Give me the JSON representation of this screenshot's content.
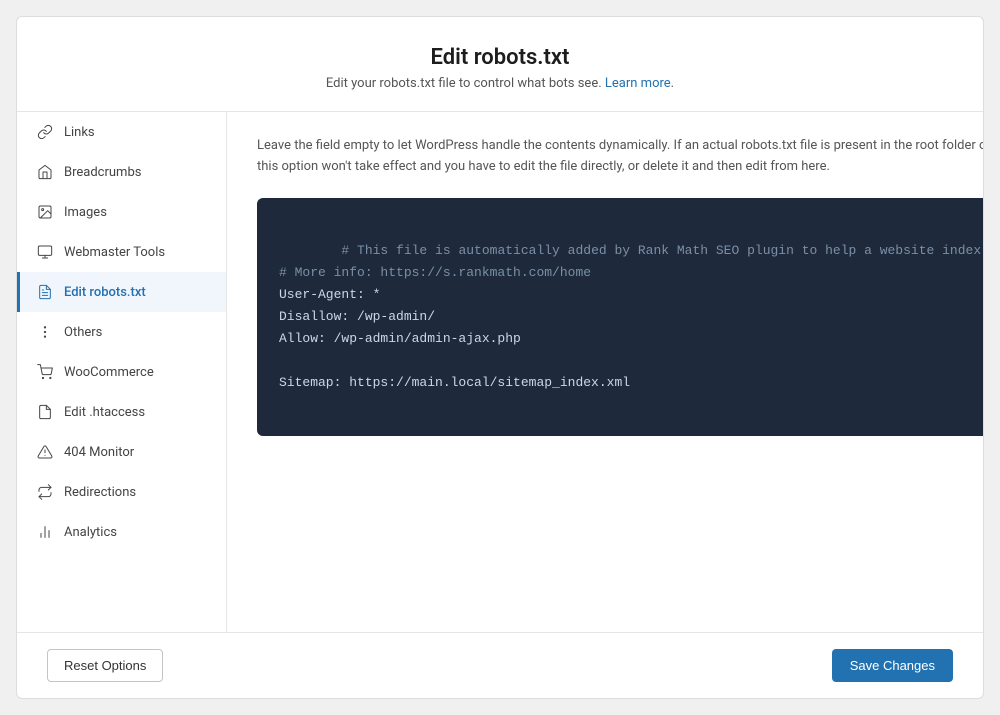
{
  "header": {
    "title": "Edit robots.txt",
    "description": "Edit your robots.txt file to control what bots see.",
    "learn_more": "Learn more",
    "learn_more_url": "#"
  },
  "sidebar": {
    "items": [
      {
        "id": "links",
        "label": "Links",
        "icon": "links"
      },
      {
        "id": "breadcrumbs",
        "label": "Breadcrumbs",
        "icon": "breadcrumbs"
      },
      {
        "id": "images",
        "label": "Images",
        "icon": "images"
      },
      {
        "id": "webmaster-tools",
        "label": "Webmaster Tools",
        "icon": "webmaster"
      },
      {
        "id": "edit-robots",
        "label": "Edit robots.txt",
        "icon": "edit-robots",
        "active": true
      },
      {
        "id": "others",
        "label": "Others",
        "icon": "others"
      },
      {
        "id": "woocommerce",
        "label": "WooCommerce",
        "icon": "woocommerce"
      },
      {
        "id": "edit-htaccess",
        "label": "Edit .htaccess",
        "icon": "edit-htaccess"
      },
      {
        "id": "404-monitor",
        "label": "404 Monitor",
        "icon": "404-monitor"
      },
      {
        "id": "redirections",
        "label": "Redirections",
        "icon": "redirections"
      },
      {
        "id": "analytics",
        "label": "Analytics",
        "icon": "analytics"
      }
    ]
  },
  "main": {
    "description": "Leave the field empty to let WordPress handle the contents dynamically. If an actual robots.txt file is present in the root folder of your site, this option won't take effect and you have to edit the file directly, or delete it and then edit from here.",
    "robots_content": "# This file is automatically added by Rank Math SEO plugin to help a website index better\n# More info: https://s.rankmath.com/home\nUser-Agent: *\nDisallow: /wp-admin/\nAllow: /wp-admin/admin-ajax.php\n\nSitemap: https://main.local/sitemap_index.xml"
  },
  "footer": {
    "reset_label": "Reset Options",
    "save_label": "Save Changes"
  }
}
